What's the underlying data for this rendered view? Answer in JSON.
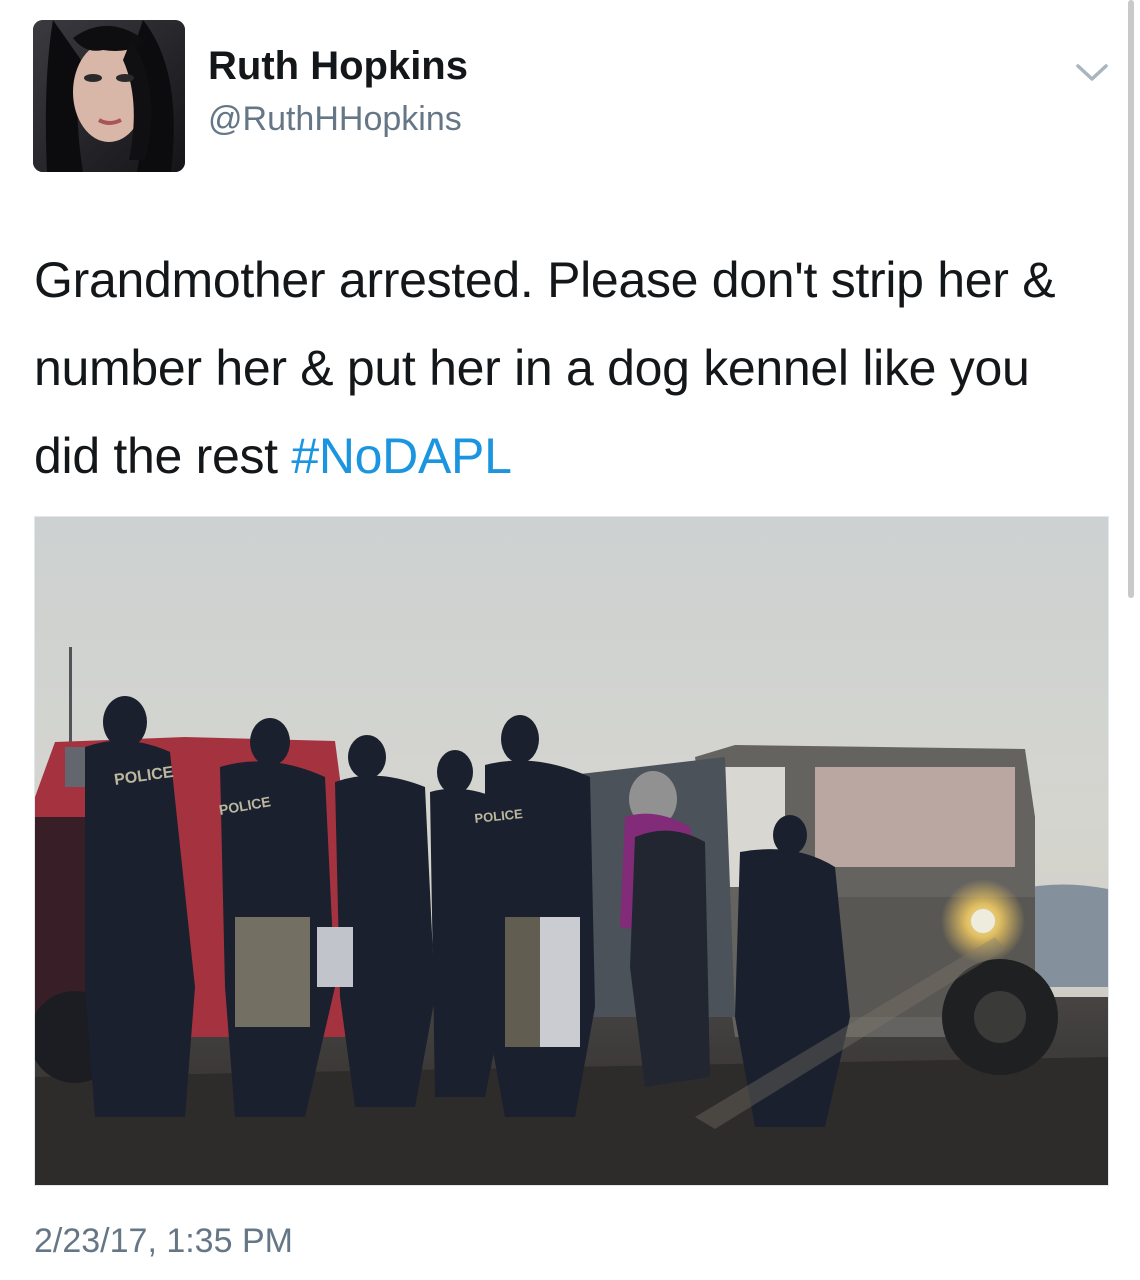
{
  "tweet": {
    "author": {
      "display_name": "Ruth Hopkins",
      "handle": "@RuthHHopkins"
    },
    "text": "Grandmother arrested. Please don't strip her & number her & put her in a dog kennel like you did the rest ",
    "hashtag": "#NoDAPL",
    "timestamp": "2/23/17, 1:35 PM"
  },
  "media": {
    "vest_labels": [
      "POLICE",
      "POLICE",
      "POLICE"
    ]
  },
  "icons": {
    "menu": "chevron-down-icon"
  },
  "colors": {
    "hashtag": "#1b95e0",
    "secondary_text": "#657786",
    "primary_text": "#14171a"
  }
}
